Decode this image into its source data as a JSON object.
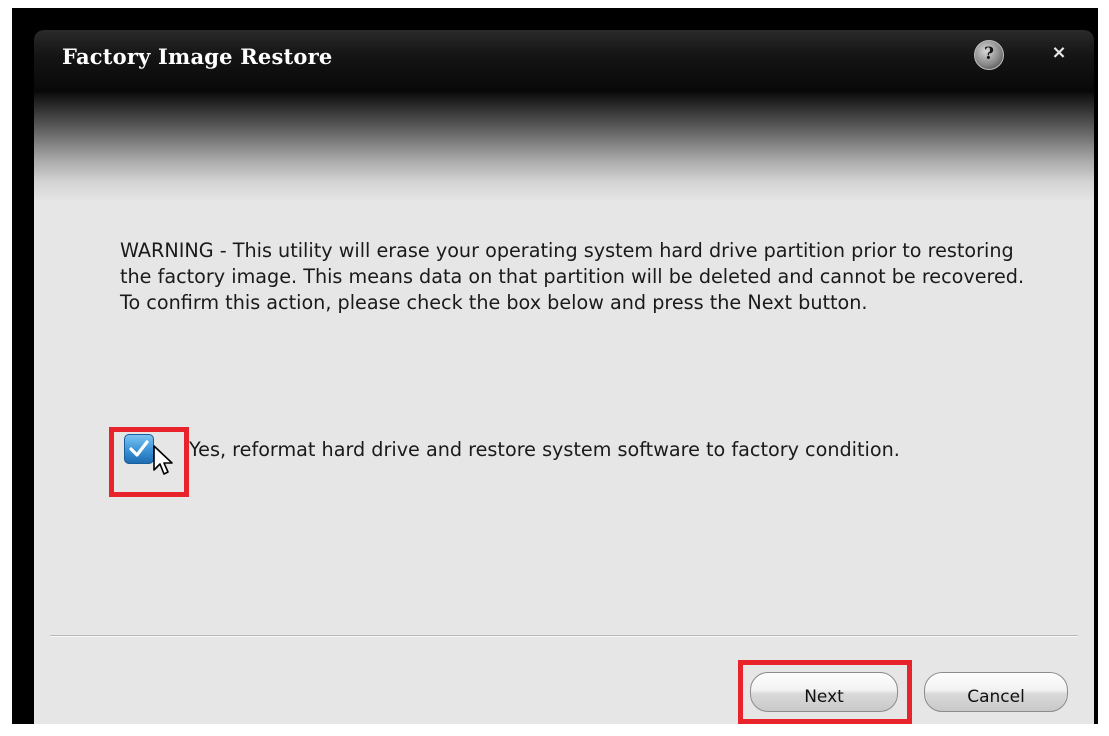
{
  "window": {
    "title": "Factory Image Restore",
    "help_label": "?",
    "close_label": "×"
  },
  "content": {
    "warning_text": "WARNING - This utility will erase your operating system hard drive partition prior to restoring the factory image. This means data on that partition will be deleted and cannot be recovered. To confirm this action, please check the box below and press the Next button.",
    "checkbox_checked": true,
    "checkbox_label": "Yes, reformat hard drive and restore system software to factory condition."
  },
  "buttons": {
    "next_label": "Next",
    "cancel_label": "Cancel"
  },
  "colors": {
    "highlight": "#e8232b",
    "checkbox_fill": "#3a93d6",
    "titlebar": "#000000",
    "client_background": "#e6e6e6"
  }
}
